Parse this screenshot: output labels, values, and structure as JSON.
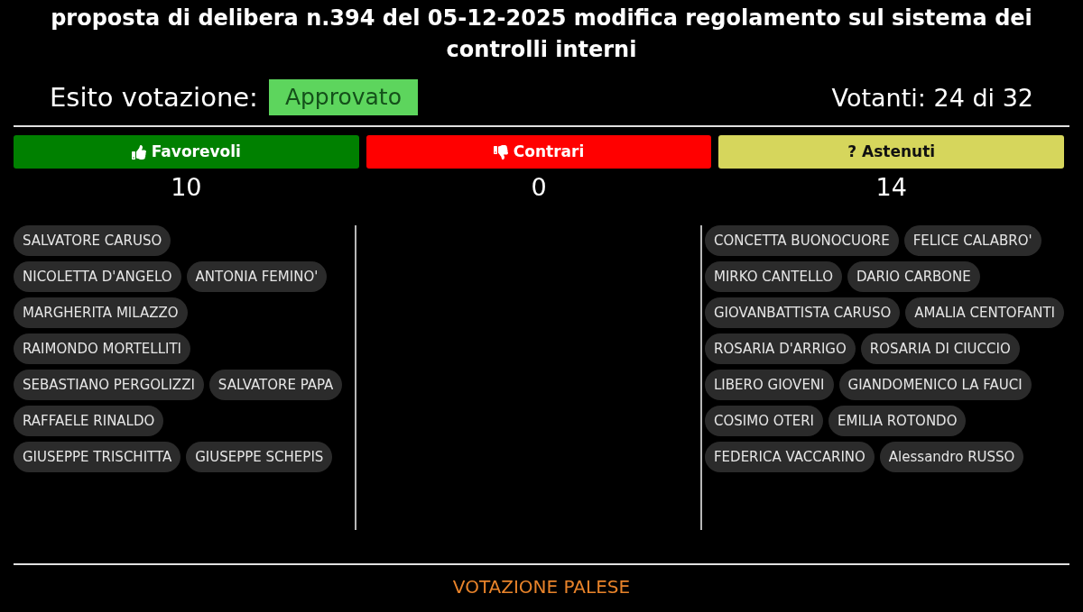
{
  "title": "proposta di delibera n.394 del 05-12-2025 modifica regolamento sul sistema dei controlli interni",
  "result": {
    "label": "Esito votazione:",
    "value": "Approvato",
    "kind": "approved"
  },
  "voters": "Votanti: 24 di 32",
  "groups": [
    {
      "kind": "favor",
      "label": "Favorevoli",
      "color": "#008000",
      "count": "10",
      "rows": [
        [
          "SALVATORE CARUSO"
        ],
        [
          "NICOLETTA D'ANGELO",
          "ANTONIA FEMINO'"
        ],
        [
          "MARGHERITA MILAZZO"
        ],
        [
          "RAIMONDO MORTELLITI"
        ],
        [
          "SEBASTIANO PERGOLIZZI",
          "SALVATORE PAPA"
        ],
        [
          "RAFFAELE RINALDO"
        ],
        [
          "GIUSEPPE TRISCHITTA",
          "GIUSEPPE SCHEPIS"
        ]
      ]
    },
    {
      "kind": "against",
      "label": "Contrari",
      "color": "#ff0000",
      "count": "0"
    },
    {
      "kind": "abstain",
      "symbol": "?",
      "label": "Astenuti",
      "color": "#d6d65c",
      "count": "14",
      "rows": [
        [
          "CONCETTA BUONOCUORE",
          "FELICE CALABRO'"
        ],
        [
          "MIRKO CANTELLO",
          "DARIO CARBONE"
        ],
        [
          "GIOVANBATTISTA CARUSO",
          "AMALIA CENTOFANTI"
        ],
        [
          "ROSARIA D'ARRIGO",
          "ROSARIA DI CIUCCIO"
        ],
        [
          "LIBERO GIOVENI",
          "GIANDOMENICO LA FAUCI"
        ],
        [
          "COSIMO OTERI",
          "EMILIA ROTONDO"
        ],
        [
          "FEDERICA VACCARINO",
          "Alessandro RUSSO"
        ]
      ]
    }
  ],
  "footer": "VOTAZIONE PALESE"
}
